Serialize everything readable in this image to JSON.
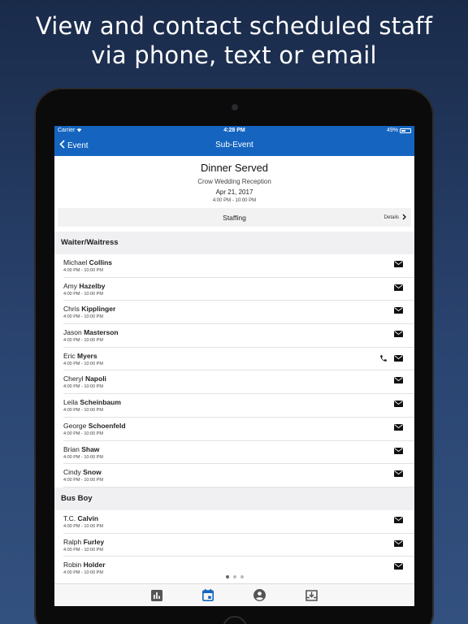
{
  "headline": {
    "line1": "View and contact scheduled staff",
    "line2": "via phone, text or email"
  },
  "status": {
    "carrier": "Carrier",
    "time": "4:28 PM",
    "battery": "49%",
    "battery_level": 0.49
  },
  "nav": {
    "back_label": "Event",
    "title": "Sub-Event"
  },
  "event": {
    "title": "Dinner Served",
    "subtitle": "Crow Wedding Reception",
    "date": "Apr 21, 2017",
    "time": "4:00 PM - 10:00 PM"
  },
  "staffing": {
    "label": "Staffing",
    "details": "Details"
  },
  "sections": [
    {
      "title": "Waiter/Waitress",
      "rows": [
        {
          "first": "Michael",
          "last": "Collins",
          "time": "4:00 PM  -  10:00 PM",
          "phone": false
        },
        {
          "first": "Amy",
          "last": "Hazelby",
          "time": "4:00 PM  -  10:00 PM",
          "phone": false
        },
        {
          "first": "Chris",
          "last": "Kipplinger",
          "time": "4:00 PM  -  10:00 PM",
          "phone": false
        },
        {
          "first": "Jason",
          "last": "Masterson",
          "time": "4:00 PM  -  10:00 PM",
          "phone": false
        },
        {
          "first": "Eric",
          "last": "Myers",
          "time": "4:00 PM  -  10:00 PM",
          "phone": true
        },
        {
          "first": "Cheryl",
          "last": "Napoli",
          "time": "4:00 PM  -  10:00 PM",
          "phone": false
        },
        {
          "first": "Leila",
          "last": "Scheinbaum",
          "time": "4:00 PM  -  10:00 PM",
          "phone": false
        },
        {
          "first": "George",
          "last": "Schoenfeld",
          "time": "4:00 PM  -  10:00 PM",
          "phone": false
        },
        {
          "first": "Brian",
          "last": "Shaw",
          "time": "4:00 PM  -  10:00 PM",
          "phone": false
        },
        {
          "first": "Cindy",
          "last": "Snow",
          "time": "4:00 PM  -  10:00 PM",
          "phone": false
        }
      ]
    },
    {
      "title": "Bus Boy",
      "rows": [
        {
          "first": "T.C.",
          "last": "Calvin",
          "time": "4:00 PM  -  10:00 PM",
          "phone": false
        },
        {
          "first": "Ralph",
          "last": "Furley",
          "time": "4:00 PM  -  10:00 PM",
          "phone": false
        },
        {
          "first": "Robin",
          "last": "Holder",
          "time": "4:00 PM  -  10:00 PM",
          "phone": false
        }
      ]
    }
  ],
  "pager": {
    "count": 3,
    "active": 0
  },
  "tabs": [
    {
      "icon": "chart-icon",
      "active": false
    },
    {
      "icon": "calendar-icon",
      "active": true
    },
    {
      "icon": "account-icon",
      "active": false
    },
    {
      "icon": "download-icon",
      "active": false
    }
  ],
  "colors": {
    "nav": "#1565c0",
    "tab_active": "#1565c0",
    "tab_inactive": "#555555"
  }
}
